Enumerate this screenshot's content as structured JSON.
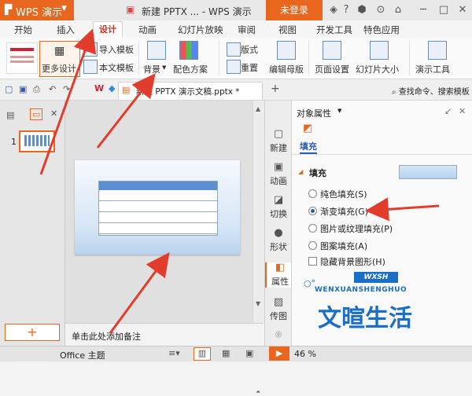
{
  "app": {
    "name": "WPS 演示",
    "title": "新建 PPTX ... - WPS 演示",
    "login": "未登录"
  },
  "tabs": [
    "开始",
    "插入",
    "设计",
    "动画",
    "幻灯片放映",
    "审阅",
    "视图",
    "开发工具",
    "特色应用"
  ],
  "ribbon": {
    "more_design": "更多设计",
    "import_template": "导入模板",
    "this_template": "本文模板",
    "background": "背景",
    "color_scheme": "配色方案",
    "layout": "版式",
    "reset": "重置",
    "edit_master": "编辑母版",
    "page_setup": "页面设置",
    "slide_size": "幻灯片大小",
    "presentation_tools": "演示工具"
  },
  "quickbar": {
    "doc_tab": "新建 PPTX 演示文稿.pptx *",
    "search": "查找命令、搜索模板"
  },
  "left_panel": {
    "slide_number": "1",
    "add_label": "+"
  },
  "notes": {
    "placeholder": "单击此处添加备注"
  },
  "side_tools": [
    "新建",
    "动画",
    "切换",
    "形状",
    "属性",
    "传图"
  ],
  "properties": {
    "title": "对象属性",
    "tab_fill": "填充",
    "section": "填充",
    "options": [
      "纯色填充(S)",
      "渐变填充(G)",
      "图片或纹理填充(P)",
      "图案填充(A)"
    ],
    "selected_option_index": 1,
    "hide_background": "隐藏背景图形(H)",
    "fill_swatch_color": "#b7d2ef"
  },
  "status": {
    "theme": "Office 主题",
    "zoom": "46 %"
  },
  "watermark": {
    "site": "WXSH",
    "pinyin": "WENXUANSHENGHUO",
    "name": "文暄生活"
  },
  "colors": {
    "accent": "#e8661e",
    "arrow": "#e23c2c",
    "table_header": "#5b8fd0"
  }
}
